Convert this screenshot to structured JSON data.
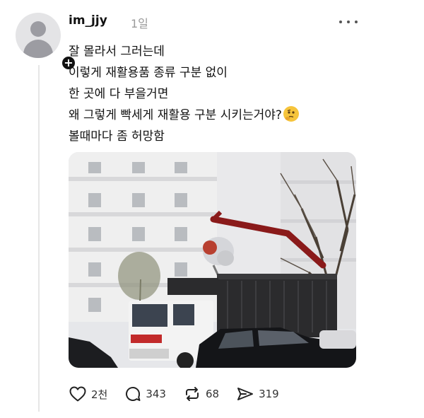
{
  "post": {
    "username": "im_jjy",
    "timestamp": "1일",
    "body_lines": [
      "잘 몰라서 그러는데",
      "이렇게 재활용품 종류 구분 없이",
      "한 곳에 다 부을거면",
      "왜 그렇게 빡세게 재활용 구분 시키는거야?",
      "볼때마다 좀 허망함"
    ],
    "emoji": "thinking-face-emoji",
    "image": "photo-truck-crane-dumping-recycling-bags"
  },
  "actions": {
    "like_count": "2천",
    "comment_count": "343",
    "repost_count": "68",
    "share_count": "319"
  },
  "icons": {
    "avatar": "default-avatar-icon",
    "follow": "plus-icon",
    "more": "more-horizontal-icon",
    "like": "heart-icon",
    "comment": "comment-icon",
    "repost": "repost-icon",
    "share": "send-icon"
  },
  "colors": {
    "text": "#111111",
    "muted": "#9a9a9a",
    "divider": "#e6e6e6",
    "avatar_bg": "#e4e4e6"
  }
}
